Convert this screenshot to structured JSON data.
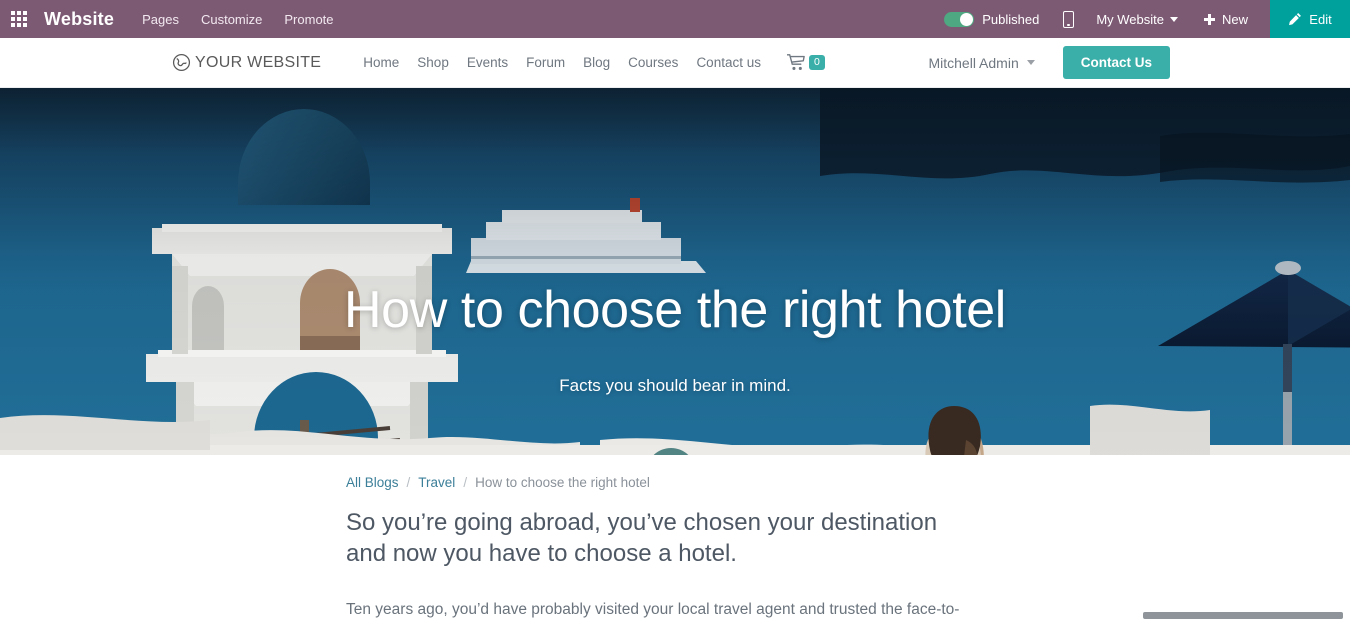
{
  "backend_bar": {
    "apps_icon": "apps-grid-icon",
    "brand": "Website",
    "menu": [
      "Pages",
      "Customize",
      "Promote"
    ],
    "published_label": "Published",
    "published_state": true,
    "mobile_preview_icon": "mobile-phone-icon",
    "website_selector": "My Website",
    "new_label": "New",
    "new_icon": "plus-icon",
    "edit_label": "Edit",
    "edit_icon": "pencil-icon",
    "bar_color": "#7d5a74",
    "edit_color": "#00a09d",
    "toggle_on_color": "#4ea881"
  },
  "site_nav": {
    "logo_icon": "globe-icon",
    "logo_text": "YOUR WEBSITE",
    "links": [
      "Home",
      "Shop",
      "Events",
      "Forum",
      "Blog",
      "Courses",
      "Contact us"
    ],
    "cart_icon": "shopping-cart-icon",
    "cart_count": "0",
    "user_name": "Mitchell Admin",
    "cta_label": "Contact Us",
    "accent_color": "#3aafa9"
  },
  "hero": {
    "title": "How to choose the right hotel",
    "subtitle": "Facts you should bear in mind.",
    "scroll_icon": "chevron-down-icon",
    "scroll_button_color": "#266666",
    "sea_color": "#1d6a94",
    "dome_color": "#1c5f86",
    "umbrella_color": "#0f2340"
  },
  "article": {
    "breadcrumb": {
      "all_blogs": "All Blogs",
      "category": "Travel",
      "current": "How to choose the right hotel",
      "separator": "/"
    },
    "lead": "So you’re going abroad, you’ve chosen your destination and now you have to choose a hotel.",
    "paragraph": "Ten years ago, you’d have probably visited your local travel agent and trusted the face-to-"
  }
}
